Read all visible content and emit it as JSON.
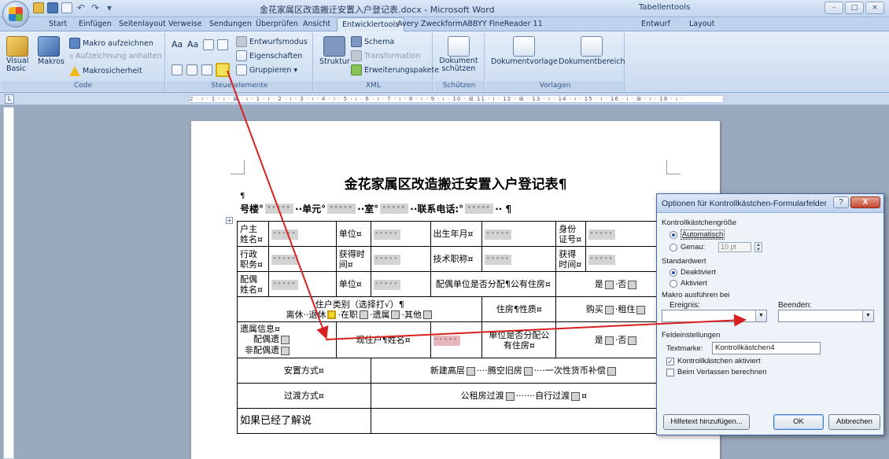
{
  "window": {
    "title": "金花家属区改造搬迁安置入户登记表.docx - Microsoft Word",
    "context_tab": "Tabellentools"
  },
  "tabs": [
    {
      "label": "Start"
    },
    {
      "label": "Einfügen"
    },
    {
      "label": "Seitenlayout"
    },
    {
      "label": "Verweise"
    },
    {
      "label": "Sendungen"
    },
    {
      "label": "Überprüfen"
    },
    {
      "label": "Ansicht"
    },
    {
      "label": "Entwicklertools"
    },
    {
      "label": "Avery Zweckform"
    },
    {
      "label": "ABBYY FineReader 11"
    },
    {
      "label": "Entwurf"
    },
    {
      "label": "Layout"
    }
  ],
  "ribbon": {
    "code": {
      "label": "Code",
      "visual_basic": "Visual Basic",
      "macros": "Makros",
      "record": "Makro aufzeichnen",
      "pause": "Aufzeichnung anhalten",
      "security": "Makrosicherheit"
    },
    "controls": {
      "label": "Steuerelemente",
      "design_mode": "Entwurfsmodus",
      "properties": "Eigenschaften",
      "group": "Gruppieren"
    },
    "xml": {
      "label": "XML",
      "structure": "Struktur",
      "schema": "Schema",
      "transformation": "Transformation",
      "expansion": "Erweiterungspakete"
    },
    "protect": {
      "label": "Schützen",
      "protect_doc": "Dokument schützen"
    },
    "templates": {
      "label": "Vorlagen",
      "doc_template": "Dokumentvorlage",
      "doc_panel": "Dokumentbereich"
    }
  },
  "ruler": {
    "scale": "2 · ı · 1 · ı · ⊠ · ı · 1 · ı · 2 · ı · 3 · ı · 4 · ı · 5 · ı · 6 · ı · 7 · ı · 8 · ı · 9 · ı · 10 · ⊞ 11 · ı · 12 · ⊞ · 13 · ı · 14 · ı · 15 · ı · 16 · ı · ⊞ · ı · 18 · ı ·"
  },
  "document": {
    "title": "金花家属区改造搬迁安置入户登记表¶",
    "para_mark": "¶",
    "field_placeholder": "°°°°°",
    "info_line": {
      "building": "号楼°",
      "unit": "··单元°",
      "room": "··室°",
      "phone": "··联系电话:°",
      "end": "·· ¶"
    },
    "table": {
      "row1": {
        "head_name": "户主姓名¤",
        "unit": "单位¤",
        "birth": "出生年月¤",
        "id": "身份证号¤"
      },
      "row2": {
        "post": "行政职务¤",
        "obtain_time": "获得时间¤",
        "tech_title": "技术职称¤",
        "obtain_time2": "获得时间¤"
      },
      "row3": {
        "spouse": "配偶姓名¤",
        "unit": "单位¤",
        "spouse_house": "配偶单位是否分配¶公有住房¤",
        "yes": "是",
        "no": "·否"
      },
      "row4": {
        "category": "住户类别（选择打√）¶",
        "retired_cadre": "离休··退休",
        "in_service": "·在职",
        "survivor": "·遗属",
        "other": "·其他",
        "house_nature": "住房¶性质¤",
        "buy": "购买",
        "rent": "·租住"
      },
      "row5": {
        "survivor_info": "遗属信息¤",
        "spouse_surv": "配偶遗",
        "non_spouse": "非配偶遗",
        "current_head": "现住户¶姓名¤",
        "unit_house": "单位是否分配公有住房¤",
        "yes": "是",
        "no": "·否"
      },
      "row6": {
        "resettle": "安置方式¤",
        "new_high": "新建高层",
        "old_vacant": "····腾空旧房",
        "cash": "····一次性货币补偿"
      },
      "row7": {
        "transition": "过渡方式¤",
        "public_rent": "公租房过渡",
        "self": "·······自行过渡",
        "end": "¤"
      },
      "row8": {
        "note": "如果已经了解说"
      }
    }
  },
  "dialog": {
    "title": "Optionen für Kontrollkästchen-Formularfelder",
    "help": "?",
    "close": "X",
    "size_section": "Kontrollkästchengröße",
    "auto": "Automatisch",
    "exact": "Genau:",
    "exact_value": "10 pt",
    "default_section": "Standardwert",
    "deactivated": "Deaktiviert",
    "activated": "Aktiviert",
    "macro_section": "Makro ausführen bei",
    "on_entry": "Ereignis:",
    "on_exit": "Beenden:",
    "field_section": "Feldeinstellungen",
    "bookmark_label": "Textmarke:",
    "bookmark_value": "Kontrollkästchen4",
    "enabled": "Kontrollkästchen aktiviert",
    "calc_on_exit": "Beim Verlassen berechnen",
    "add_help": "Hilfetext hinzufügen...",
    "ok": "OK",
    "cancel": "Abbrechen"
  }
}
